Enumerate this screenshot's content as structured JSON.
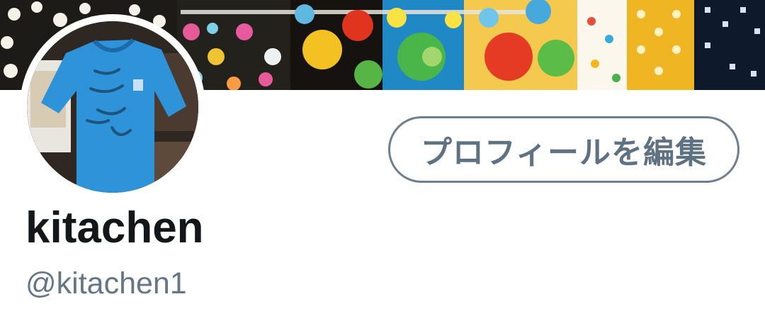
{
  "profile": {
    "display_name": "kitachen",
    "handle": "@kitachen1",
    "edit_profile_label": "プロフィールを編集"
  },
  "images": {
    "banner": "polka-dot fabric header image",
    "avatar": "blue signed t-shirt photo"
  },
  "colors": {
    "button_border": "#6d7f90",
    "button_text": "#5f7283",
    "name_text": "#14171a",
    "handle_text": "#657786"
  }
}
